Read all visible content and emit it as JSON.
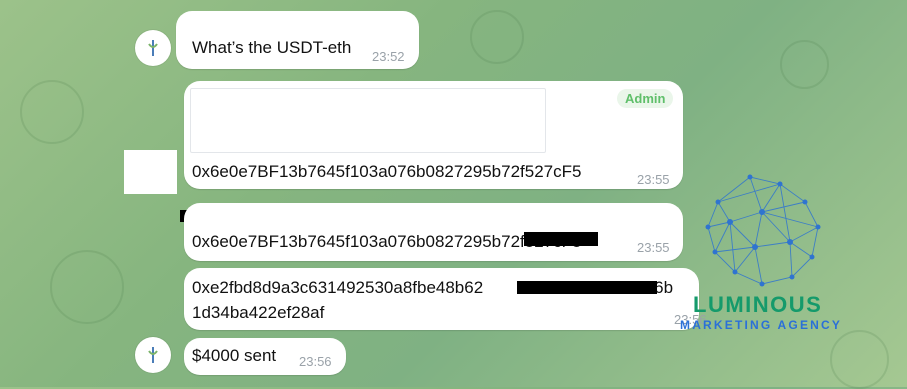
{
  "messages": [
    {
      "text": "What’s the USDT-eth",
      "time": "23:52"
    },
    {
      "badge": "Admin",
      "text": "0x6e0e7BF13b7645f103a076b0827295b72f527cF5",
      "time": "23:55"
    },
    {
      "text": "0x6e0e7BF13b7645f103a076b0827295b72f527cF5",
      "time": "23:55"
    },
    {
      "text_line1": "0xe2fbd8d9a3c631492530a8fbe48b62",
      "text_line1_end": "fac26b",
      "text_line2": "1d34ba422ef28af",
      "time": "23:56"
    },
    {
      "text": "$4000 sent",
      "time": "23:56"
    }
  ],
  "watermark": {
    "title": "LUMINOUS",
    "subtitle": "MARKETING AGENCY"
  },
  "colors": {
    "bubble": "#ffffff",
    "admin_badge": "#5fbf6a",
    "watermark_title": "#159a6b",
    "watermark_sub": "#2b70d8"
  }
}
